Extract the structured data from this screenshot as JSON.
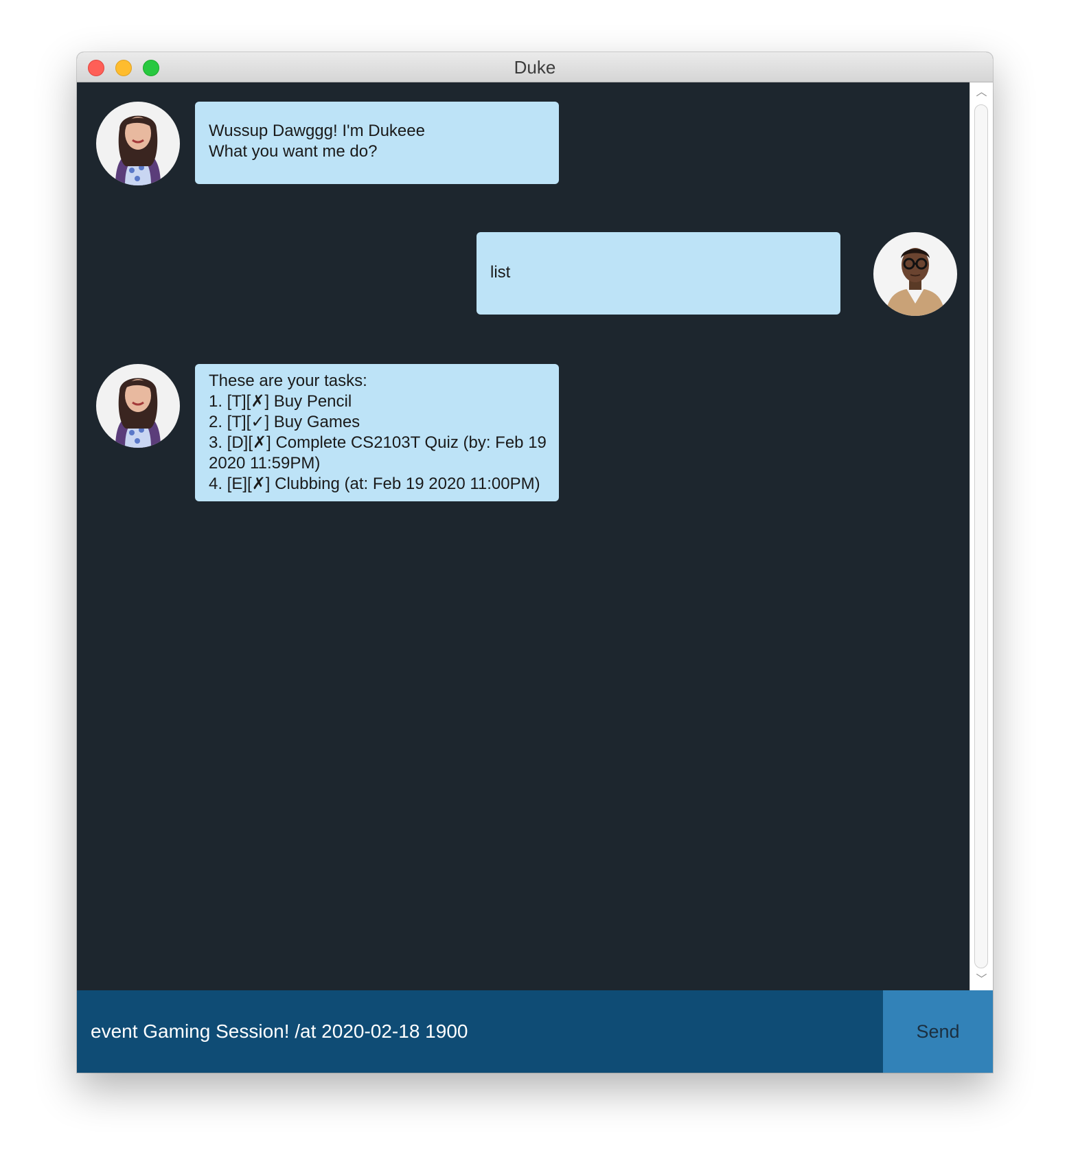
{
  "window": {
    "title": "Duke"
  },
  "chat": {
    "messages": [
      {
        "sender": "duke",
        "lines": [
          "Wussup Dawggg! I'm Dukeee",
          "What you want me do?"
        ]
      },
      {
        "sender": "user",
        "lines": [
          "list"
        ]
      },
      {
        "sender": "duke",
        "lines": [
          "These are your tasks:",
          "1. [T][✗] Buy Pencil",
          "2. [T][✓] Buy Games",
          "3. [D][✗] Complete CS2103T Quiz (by: Feb 19",
          "2020 11:59PM)",
          "4. [E][✗] Clubbing (at: Feb 19 2020 11:00PM)"
        ]
      }
    ]
  },
  "input": {
    "value": "event Gaming Session! /at 2020-02-18 1900"
  },
  "send_button": {
    "label": "Send"
  },
  "colors": {
    "chat_background": "#1d262e",
    "bubble": "#bde3f7",
    "input_bar": "#0f4c75",
    "send_button": "#3282b8"
  },
  "icons": {
    "duke_avatar": "woman-portrait-avatar",
    "user_avatar": "man-portrait-avatar"
  }
}
